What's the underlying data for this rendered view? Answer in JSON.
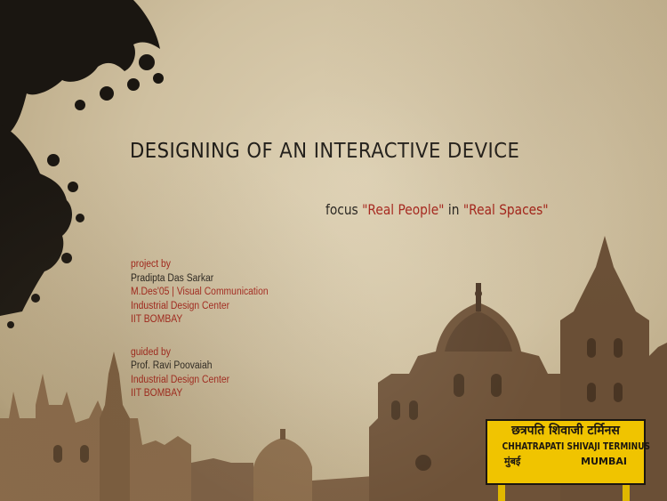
{
  "slide": {
    "title": "DESIGNING OF AN INTERACTIVE DEVICE",
    "subtitle": {
      "word1": "focus",
      "quote1": "\"Real People\"",
      "word2": "in",
      "quote2": "\"Real Spaces\""
    },
    "project": {
      "heading": "project by",
      "name": "Pradipta Das Sarkar",
      "program": "M.Des'05 | Visual Communication",
      "institute": "Industrial Design Center",
      "university": "IIT BOMBAY"
    },
    "guide": {
      "heading": "guided by",
      "name": "Prof. Ravi Poovaiah",
      "institute": "Industrial Design Center",
      "university": "IIT BOMBAY"
    },
    "sign": {
      "line1": "छत्रपति शिवाजी टर्मिनस",
      "line2": "CHHATRAPATI SHIVAJI TERMINUS",
      "line3a": "मुंबई",
      "line3b": "MUMBAI"
    }
  },
  "colors": {
    "accent_red": "#a21d14",
    "text_dark": "#1d1a16",
    "sign_yellow": "#f0c400"
  }
}
